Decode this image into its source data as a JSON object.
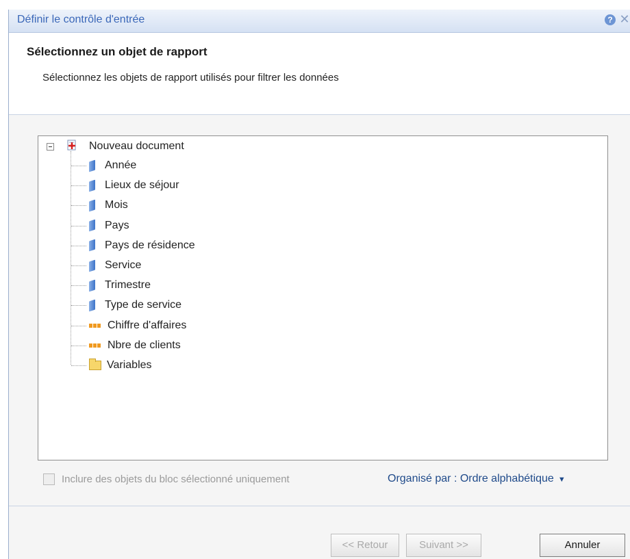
{
  "dialog": {
    "title": "Définir le contrôle d'entrée",
    "help_label": "?",
    "close_label": "✕"
  },
  "header": {
    "title": "Sélectionnez un objet de rapport",
    "subtitle": "Sélectionnez les objets de rapport utilisés pour filtrer les données"
  },
  "tree": {
    "root": {
      "label": "Nouveau document",
      "icon": "document-icon",
      "expanded": true
    },
    "items": [
      {
        "label": "Année",
        "icon": "dimension-icon"
      },
      {
        "label": "Lieux de séjour",
        "icon": "dimension-icon"
      },
      {
        "label": "Mois",
        "icon": "dimension-icon"
      },
      {
        "label": "Pays",
        "icon": "dimension-icon"
      },
      {
        "label": "Pays de résidence",
        "icon": "dimension-icon"
      },
      {
        "label": "Service",
        "icon": "dimension-icon"
      },
      {
        "label": "Trimestre",
        "icon": "dimension-icon"
      },
      {
        "label": "Type de service",
        "icon": "dimension-icon"
      },
      {
        "label": "Chiffre d'affaires",
        "icon": "measure-icon"
      },
      {
        "label": "Nbre de clients",
        "icon": "measure-icon"
      },
      {
        "label": "Variables",
        "icon": "folder-icon"
      }
    ]
  },
  "options": {
    "checkbox_label": "Inclure des objets du bloc sélectionné uniquement",
    "checkbox_checked": false,
    "organize_label": "Organisé par : Ordre alphabétique"
  },
  "buttons": {
    "back": "<< Retour",
    "next": "Suivant >>",
    "cancel": "Annuler"
  }
}
